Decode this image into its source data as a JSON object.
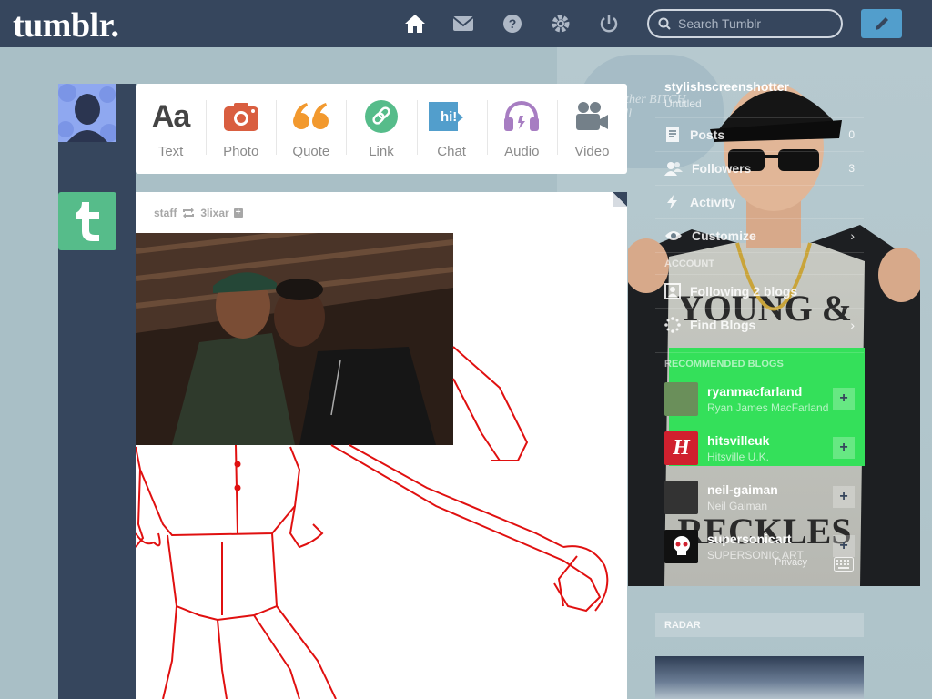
{
  "header": {
    "logo": "tumblr.",
    "search_placeholder": "Search Tumblr"
  },
  "post_types": [
    {
      "label": "Text",
      "glyph": "Aa",
      "color": "#444444"
    },
    {
      "label": "Photo",
      "color": "#d95e40"
    },
    {
      "label": "Quote",
      "glyph": "66",
      "color": "#f2992e"
    },
    {
      "label": "Link",
      "color": "#56bc8a"
    },
    {
      "label": "Chat",
      "glyph": "hi!",
      "color": "#529ecc"
    },
    {
      "label": "Audio",
      "color": "#a77dc2"
    },
    {
      "label": "Video",
      "color": "#748089"
    }
  ],
  "post": {
    "author": "staff",
    "reblogged_from": "3lixar",
    "plus": "+"
  },
  "sidebar": {
    "blog_name": "stylishscreenshotter",
    "blog_sub": "Untitled",
    "items": [
      {
        "label": "Posts",
        "count": "0"
      },
      {
        "label": "Followers",
        "count": "3"
      },
      {
        "label": "Activity"
      },
      {
        "label": "Customize",
        "chev": "›"
      }
    ],
    "account_heading": "ACCOUNT",
    "account_items": [
      {
        "label": "Following 2 blogs"
      },
      {
        "label": "Find Blogs",
        "chev": "›"
      }
    ],
    "recommended_heading": "RECOMMENDED BLOGS",
    "recommended": [
      {
        "name": "ryanmacfarland",
        "sub": "Ryan James MacFarland",
        "avatar_color": "#6a8f5a"
      },
      {
        "name": "hitsvilleuk",
        "sub": "Hitsville U.K.",
        "avatar_color": "#d0202e",
        "avatar_glyph": "H"
      },
      {
        "name": "neil-gaiman",
        "sub": "Neil Gaiman",
        "avatar_color": "#333333"
      },
      {
        "name": "supersonicart",
        "sub": "SUPERSONIC ART",
        "avatar_color": "#111111"
      }
    ],
    "follow_glyph": "+",
    "privacy": "Privacy",
    "radar_heading": "RADAR"
  },
  "background_text": "mother BITCH Call"
}
